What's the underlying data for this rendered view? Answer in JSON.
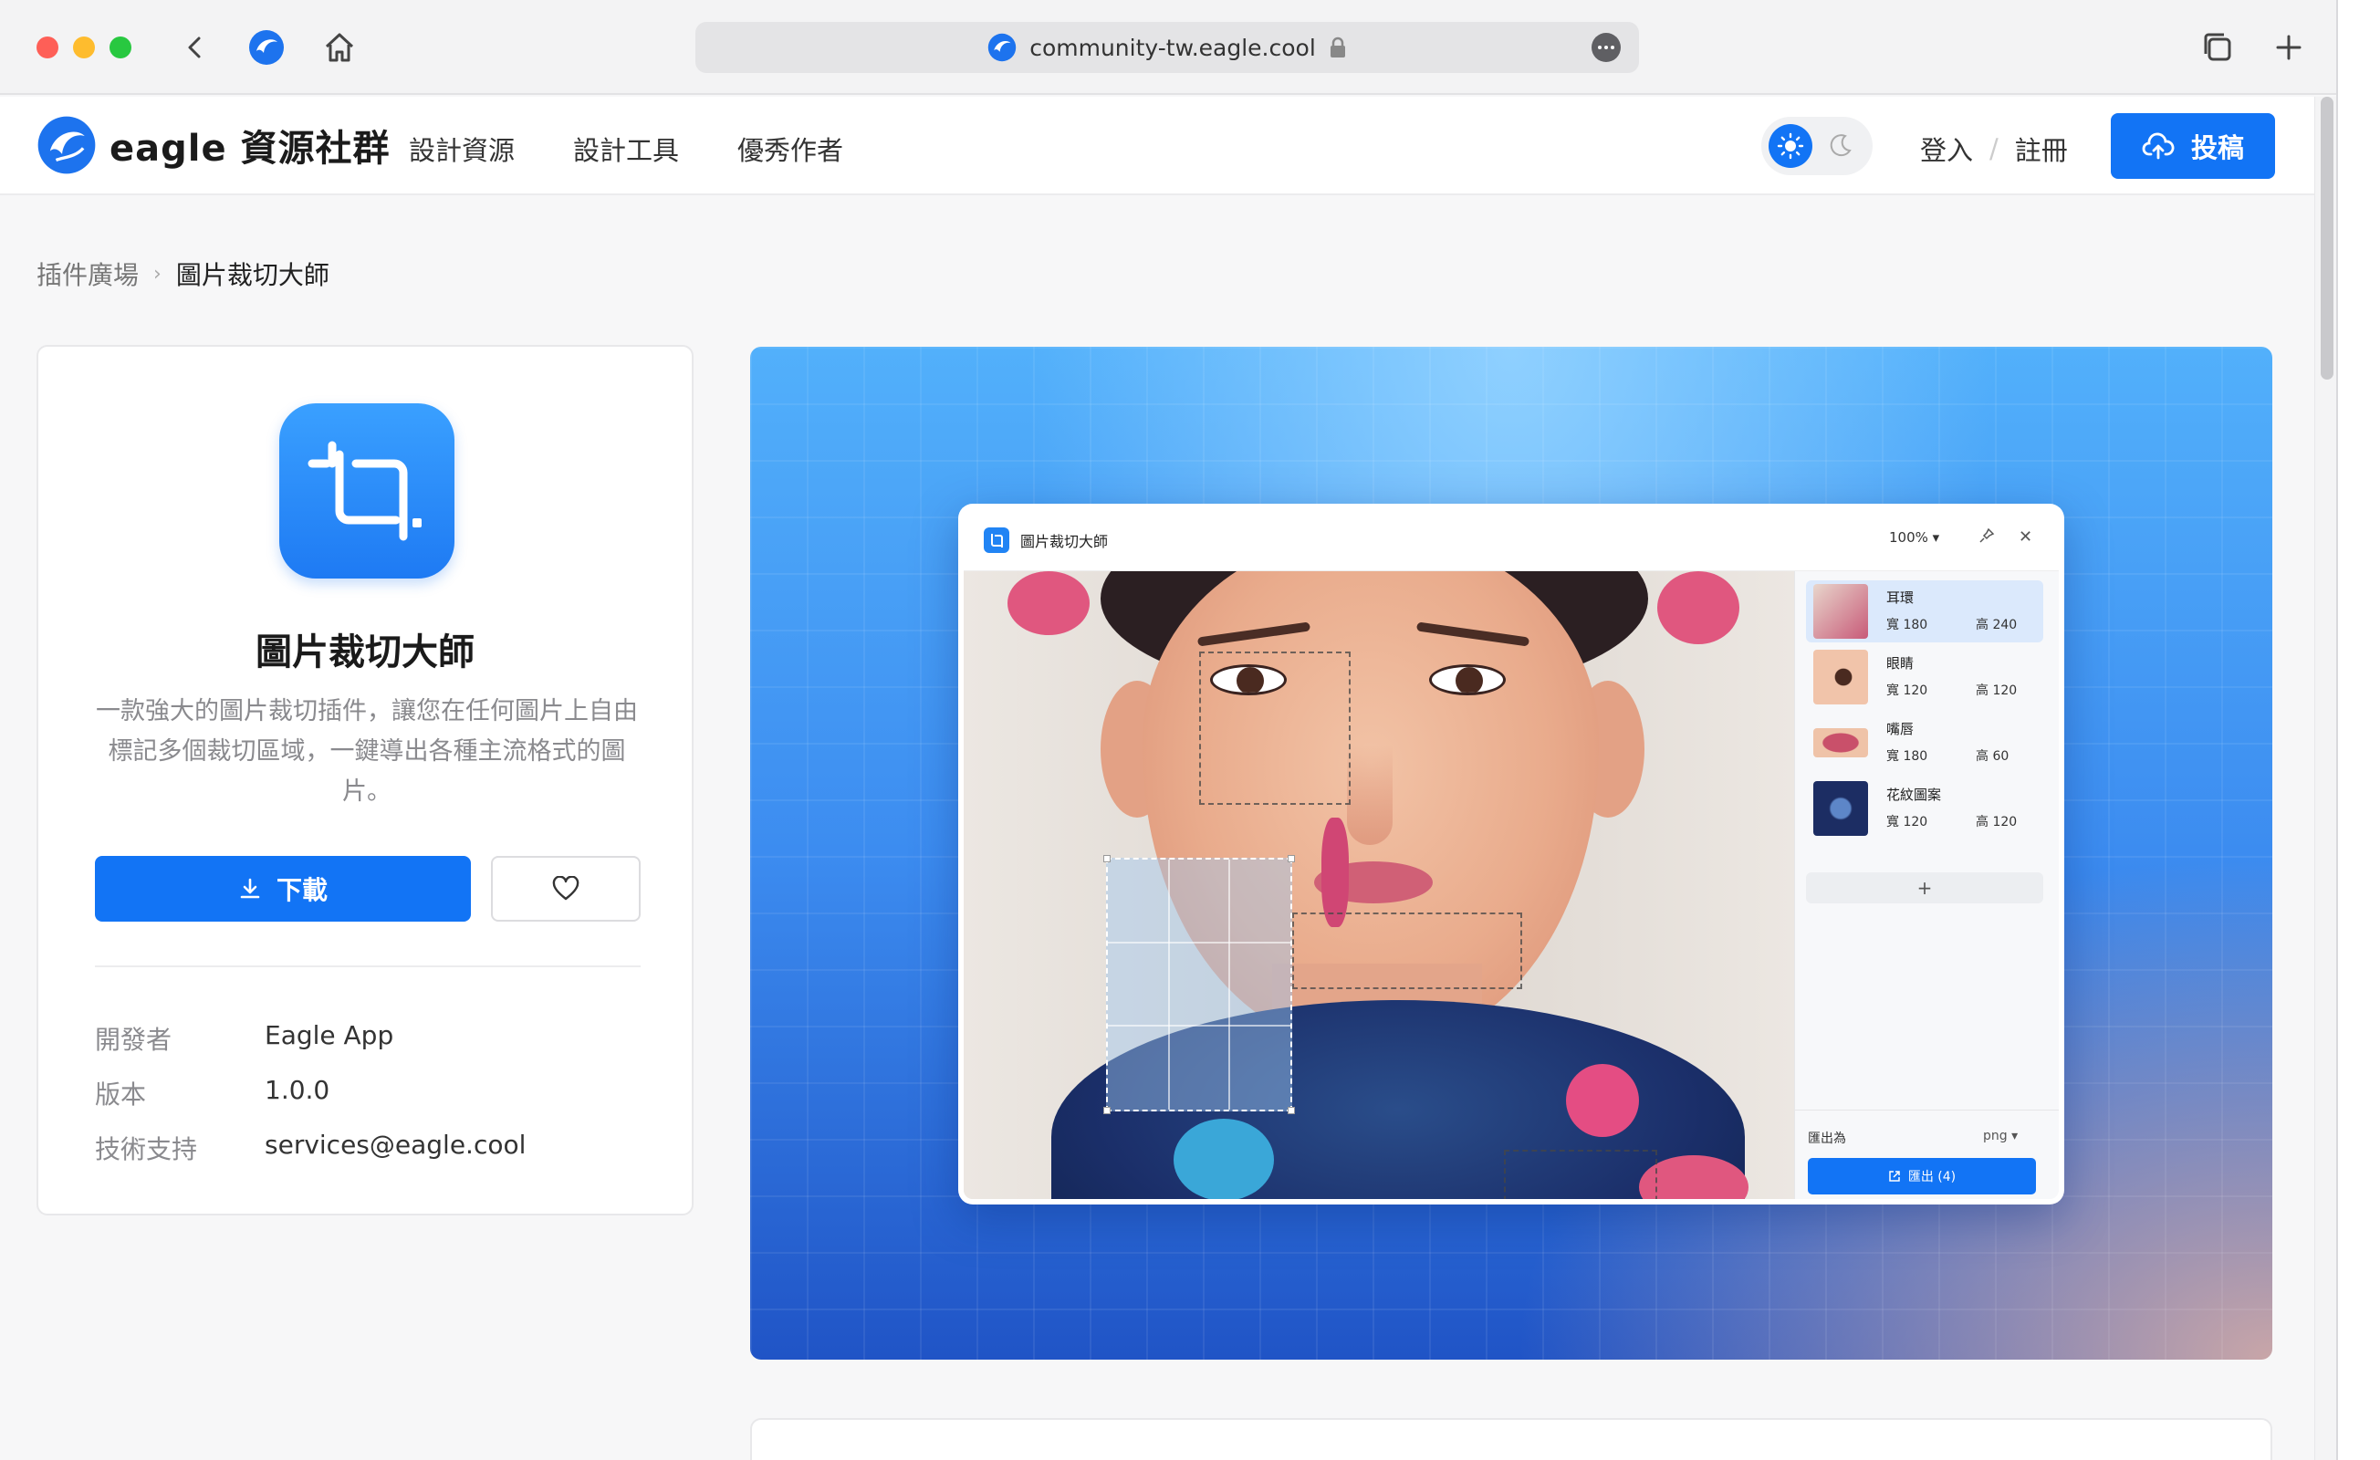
{
  "browser": {
    "url": "community-tw.eagle.cool"
  },
  "site": {
    "logo_text": "eagle 資源社群",
    "nav": [
      "設計資源",
      "設計工具",
      "優秀作者"
    ],
    "login": "登入",
    "register": "註冊",
    "submit": "投稿"
  },
  "breadcrumb": {
    "parent": "插件廣場",
    "current": "圖片裁切大師"
  },
  "plugin": {
    "title": "圖片裁切大師",
    "description": "一款強大的圖片裁切插件，讓您在任何圖片上自由標記多個裁切區域，一鍵導出各種主流格式的圖片。",
    "download_label": "下載",
    "meta": [
      {
        "label": "開發者",
        "value": "Eagle App"
      },
      {
        "label": "版本",
        "value": "1.0.0"
      },
      {
        "label": "技術支持",
        "value": "services@eagle.cool"
      }
    ]
  },
  "preview_app": {
    "title": "圖片裁切大師",
    "zoom": "100%",
    "crops": [
      {
        "name": "耳環",
        "w": "180",
        "h": "240",
        "selected": true
      },
      {
        "name": "眼睛",
        "w": "120",
        "h": "120",
        "selected": false
      },
      {
        "name": "嘴唇",
        "w": "180",
        "h": "60",
        "selected": false
      },
      {
        "name": "花紋圖案",
        "w": "120",
        "h": "120",
        "selected": false
      }
    ],
    "width_prefix": "寬",
    "height_prefix": "高",
    "add_label": "+",
    "export_as_label": "匯出為",
    "export_format": "png",
    "export_button": "匯出 (4)"
  },
  "colors": {
    "primary": "#1274f5"
  }
}
